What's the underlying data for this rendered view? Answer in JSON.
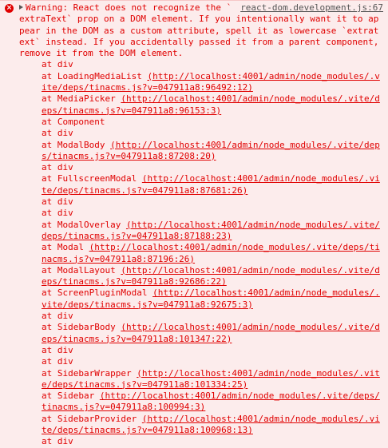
{
  "console": {
    "source": "react-dom.development.js:67",
    "message": "Warning: React does not recognize the `extraText` prop on a DOM element. If you intentionally want it to appear in the DOM as a custom attribute, spell it as lowercase `extratext` instead. If you accidentally passed it from a parent component, remove it from the DOM element.",
    "stack": [
      {
        "at": "at div",
        "url": ""
      },
      {
        "at": "at LoadingMediaList",
        "url": "(http://localhost:4001/admin/node_modules/.vite/deps/tinacms.js?v=047911a8:96492:12)"
      },
      {
        "at": "at MediaPicker",
        "url": "(http://localhost:4001/admin/node_modules/.vite/deps/tinacms.js?v=047911a8:96153:3)"
      },
      {
        "at": "at Component",
        "url": ""
      },
      {
        "at": "at div",
        "url": ""
      },
      {
        "at": "at ModalBody",
        "url": "(http://localhost:4001/admin/node_modules/.vite/deps/tinacms.js?v=047911a8:87208:20)"
      },
      {
        "at": "at div",
        "url": ""
      },
      {
        "at": "at FullscreenModal",
        "url": "(http://localhost:4001/admin/node_modules/.vite/deps/tinacms.js?v=047911a8:87681:26)"
      },
      {
        "at": "at div",
        "url": ""
      },
      {
        "at": "at div",
        "url": ""
      },
      {
        "at": "at ModalOverlay",
        "url": "(http://localhost:4001/admin/node_modules/.vite/deps/tinacms.js?v=047911a8:87188:23)"
      },
      {
        "at": "at Modal",
        "url": "(http://localhost:4001/admin/node_modules/.vite/deps/tinacms.js?v=047911a8:87196:26)"
      },
      {
        "at": "at ModalLayout",
        "url": "(http://localhost:4001/admin/node_modules/.vite/deps/tinacms.js?v=047911a8:92686:22)"
      },
      {
        "at": "at ScreenPluginModal",
        "url": "(http://localhost:4001/admin/node_modules/.vite/deps/tinacms.js?v=047911a8:92675:3)"
      },
      {
        "at": "at div",
        "url": ""
      },
      {
        "at": "at SidebarBody",
        "url": "(http://localhost:4001/admin/node_modules/.vite/deps/tinacms.js?v=047911a8:101347:22)"
      },
      {
        "at": "at div",
        "url": ""
      },
      {
        "at": "at div",
        "url": ""
      },
      {
        "at": "at SidebarWrapper",
        "url": "(http://localhost:4001/admin/node_modules/.vite/deps/tinacms.js?v=047911a8:101334:25)"
      },
      {
        "at": "at Sidebar",
        "url": "(http://localhost:4001/admin/node_modules/.vite/deps/tinacms.js?v=047911a8:100994:3)"
      },
      {
        "at": "at SidebarProvider",
        "url": "(http://localhost:4001/admin/node_modules/.vite/deps/tinacms.js?v=047911a8:100968:13)"
      },
      {
        "at": "at div",
        "url": ""
      }
    ],
    "colors": {
      "error_text": "#e00000",
      "background": "#fcecec",
      "source_link": "#555555"
    }
  }
}
